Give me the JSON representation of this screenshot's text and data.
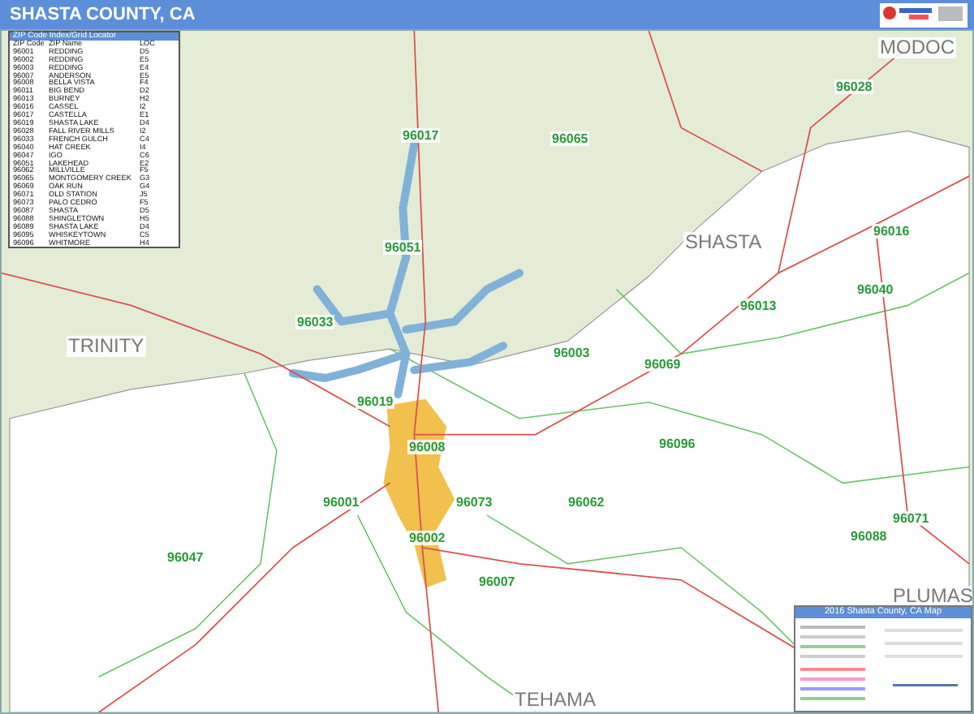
{
  "header": {
    "title": "SHASTA COUNTY, CA"
  },
  "index": {
    "title": "ZIP Code Index/Grid Locator",
    "columns": [
      "ZIP Code",
      "ZIP Name",
      "LOC"
    ],
    "rows": [
      [
        "96001",
        "REDDING",
        "D5"
      ],
      [
        "96002",
        "REDDING",
        "E5"
      ],
      [
        "96003",
        "REDDING",
        "E4"
      ],
      [
        "96007",
        "ANDERSON",
        "E5"
      ],
      [
        "96008",
        "BELLA VISTA",
        "F4"
      ],
      [
        "96011",
        "BIG BEND",
        "D2"
      ],
      [
        "96013",
        "BURNEY",
        "H2"
      ],
      [
        "96016",
        "CASSEL",
        "I2"
      ],
      [
        "96017",
        "CASTELLA",
        "E1"
      ],
      [
        "96019",
        "SHASTA LAKE",
        "D4"
      ],
      [
        "96028",
        "FALL RIVER MILLS",
        "I2"
      ],
      [
        "96033",
        "FRENCH GULCH",
        "C4"
      ],
      [
        "96040",
        "HAT CREEK",
        "I4"
      ],
      [
        "96047",
        "IGO",
        "C6"
      ],
      [
        "96051",
        "LAKEHEAD",
        "E2"
      ],
      [
        "96062",
        "MILLVILLE",
        "F5"
      ],
      [
        "96065",
        "MONTGOMERY CREEK",
        "G3"
      ],
      [
        "96069",
        "OAK RUN",
        "G4"
      ],
      [
        "96071",
        "OLD STATION",
        "J5"
      ],
      [
        "96073",
        "PALO CEDRO",
        "F5"
      ],
      [
        "96087",
        "SHASTA",
        "D5"
      ],
      [
        "96088",
        "SHINGLETOWN",
        "H5"
      ],
      [
        "96089",
        "SHASTA LAKE",
        "D4"
      ],
      [
        "96095",
        "WHISKEYTOWN",
        "C5"
      ],
      [
        "96096",
        "WHITMORE",
        "H4"
      ]
    ]
  },
  "regions": [
    "MODOC",
    "SHASTA",
    "TRINITY",
    "TEHAMA",
    "PLUMAS"
  ],
  "zip_labels": [
    "96028",
    "96017",
    "96065",
    "96016",
    "96051",
    "96013",
    "96040",
    "96033",
    "96003",
    "96069",
    "96019",
    "96008",
    "96096",
    "96001",
    "96073",
    "96062",
    "96002",
    "96088",
    "96071",
    "96047",
    "96007"
  ],
  "legend": {
    "title": "2016 Shasta County, CA Map"
  }
}
